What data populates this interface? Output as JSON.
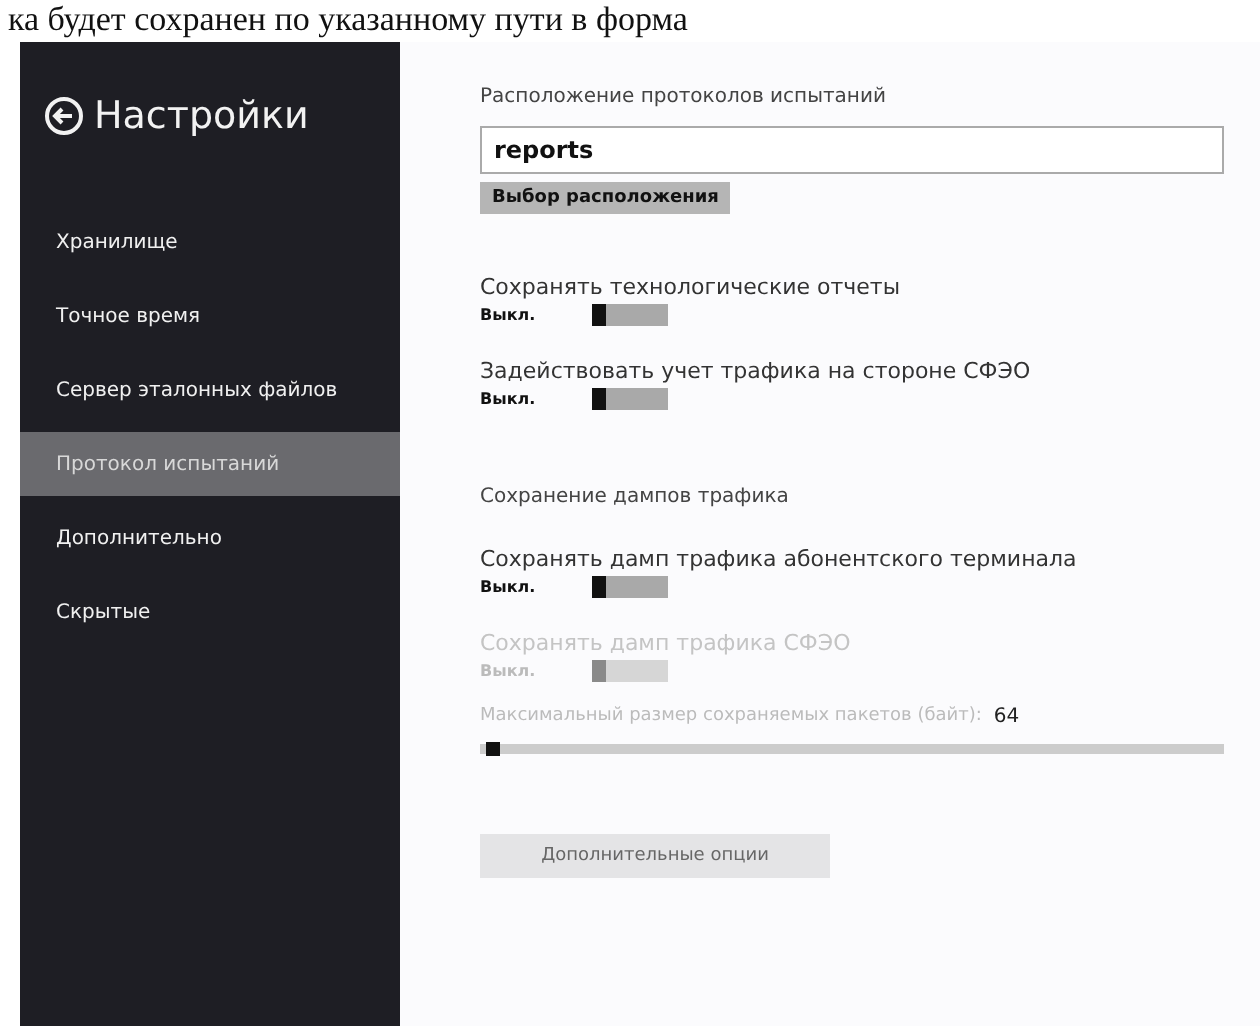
{
  "document_text": "ка будет сохранен по указанному пути в форма",
  "sidebar": {
    "title": "Настройки",
    "items": [
      {
        "label": "Хранилище",
        "selected": false
      },
      {
        "label": "Точное время",
        "selected": false
      },
      {
        "label": "Сервер эталонных файлов",
        "selected": false
      },
      {
        "label": "Протокол испытаний",
        "selected": true
      },
      {
        "label": "Дополнительно",
        "selected": false
      },
      {
        "label": "Скрытые",
        "selected": false
      }
    ]
  },
  "content": {
    "location_heading": "Расположение протоколов испытаний",
    "location_value": "reports",
    "choose_button": "Выбор расположения",
    "toggles": [
      {
        "label": "Сохранять технологические отчеты",
        "state": "Выкл.",
        "on": false,
        "disabled": false
      },
      {
        "label": "Задействовать учет трафика на стороне СФЭО",
        "state": "Выкл.",
        "on": false,
        "disabled": false
      }
    ],
    "dumps_heading": "Сохранение дампов трафика",
    "dump_toggles": [
      {
        "label": "Сохранять дамп трафика абонентского терминала",
        "state": "Выкл.",
        "on": false,
        "disabled": false
      },
      {
        "label": "Сохранять дамп трафика СФЭО",
        "state": "Выкл.",
        "on": false,
        "disabled": true
      }
    ],
    "packet_size": {
      "label": "Максимальный размер сохраняемых пакетов (байт):",
      "value": "64",
      "level": 0.01
    },
    "more_button": "Дополнительные опции"
  }
}
